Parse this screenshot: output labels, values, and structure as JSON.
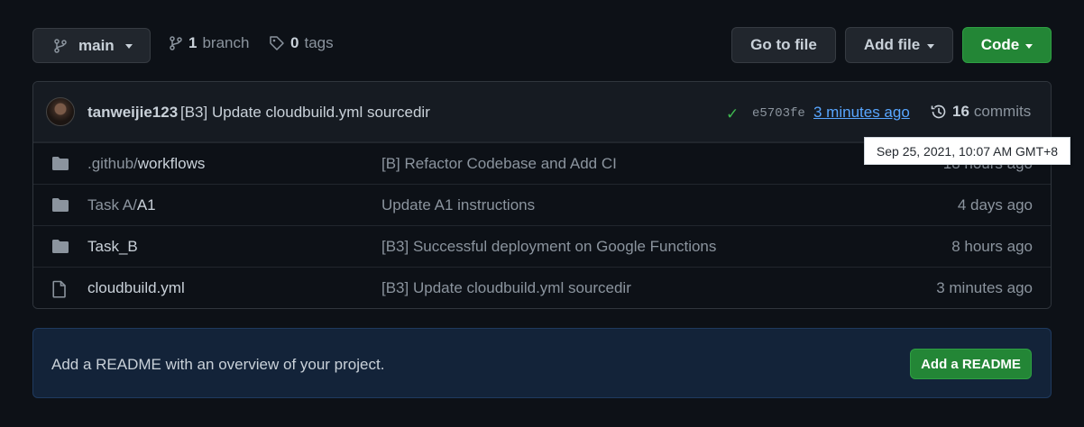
{
  "toolbar": {
    "branch_label": "main",
    "branches_count": "1",
    "branches_label": "branch",
    "tags_count": "0",
    "tags_label": "tags",
    "go_to_file": "Go to file",
    "add_file": "Add file",
    "code": "Code"
  },
  "commit": {
    "author": "tanweijie123",
    "message": "[B3] Update cloudbuild.yml sourcedir",
    "sha": "e5703fe",
    "time": "3 minutes ago",
    "commits_count": "16",
    "commits_label": "commits",
    "status_icon": "check-icon"
  },
  "tooltip": "Sep 25, 2021, 10:07 AM GMT+8",
  "files": [
    {
      "dir_prefix": ".github/",
      "name": "workflows",
      "message": "[B] Refactor Codebase and Add CI",
      "age": "18 hours ago",
      "icon": "folder-icon"
    },
    {
      "dir_prefix": "Task A/",
      "name": "A1",
      "message": "Update A1 instructions",
      "age": "4 days ago",
      "icon": "folder-icon"
    },
    {
      "dir_prefix": "",
      "name": "Task_B",
      "message": "[B3] Successful deployment on Google Functions",
      "age": "8 hours ago",
      "icon": "folder-icon"
    },
    {
      "dir_prefix": "",
      "name": "cloudbuild.yml",
      "message": "[B3] Update cloudbuild.yml sourcedir",
      "age": "3 minutes ago",
      "icon": "file-icon"
    }
  ],
  "readme": {
    "text": "Add a README with an overview of your project.",
    "button": "Add a README"
  },
  "colors": {
    "background": "#0d1117",
    "primary_button": "#238636",
    "link": "#58a6ff",
    "success": "#3fb950"
  }
}
